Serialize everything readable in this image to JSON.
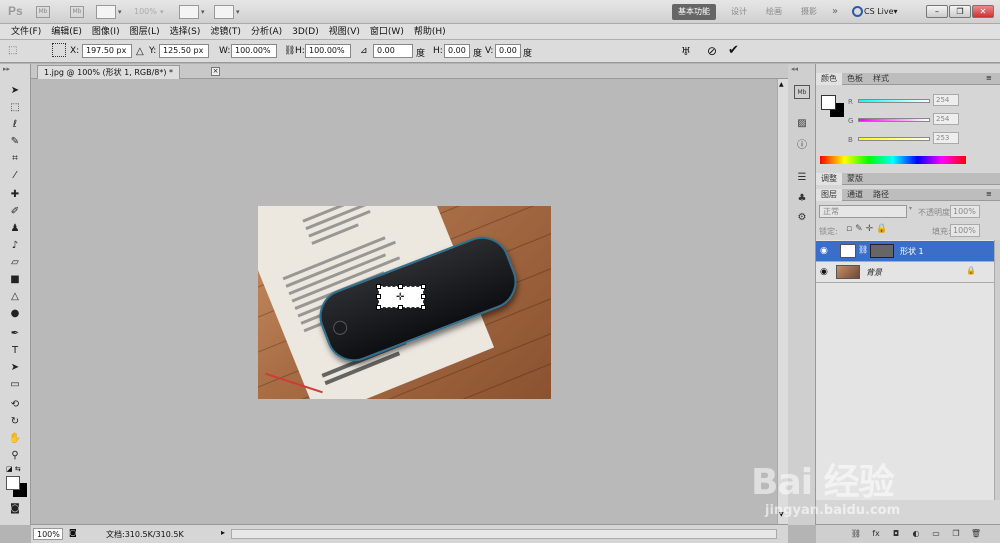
{
  "app": {
    "logo": "Ps",
    "mb_label": "Mb",
    "zoom": "100%"
  },
  "workspaces": [
    "基本功能",
    "设计",
    "绘画",
    "摄影"
  ],
  "cs_live": "CS Live▾",
  "window_buttons": [
    "–",
    "❐",
    "✕"
  ],
  "menu": [
    "文件(F)",
    "编辑(E)",
    "图像(I)",
    "图层(L)",
    "选择(S)",
    "滤镜(T)",
    "分析(A)",
    "3D(D)",
    "视图(V)",
    "窗口(W)",
    "帮助(H)"
  ],
  "options": {
    "x_label": "X:",
    "x_value": "197.50 px",
    "y_label": "Y:",
    "y_value": "125.50 px",
    "w_label": "W:",
    "w_value": "100.00%",
    "h_label": "H:",
    "h_value": "100.00%",
    "angle_value": "0.00",
    "angle_unit": "度",
    "hskew_label": "H:",
    "hskew_value": "0.00",
    "hskew_unit": "度",
    "vskew_label": "V:",
    "vskew_value": "0.00",
    "vskew_unit": "度"
  },
  "document": {
    "tab_title": "1.jpg @ 100% (形状 1, RGB/8*) *",
    "close": "×"
  },
  "status": {
    "zoom": "100%",
    "doc_info": "文档:310.5K/310.5K"
  },
  "color_panel": {
    "tabs": [
      "颜色",
      "色板",
      "样式"
    ],
    "channels": [
      {
        "label": "R",
        "value": "254"
      },
      {
        "label": "G",
        "value": "254"
      },
      {
        "label": "B",
        "value": "253"
      }
    ]
  },
  "adjust_panel": {
    "tabs": [
      "调整",
      "蒙版"
    ]
  },
  "layers_panel": {
    "tabs": [
      "图层",
      "通道",
      "路径"
    ],
    "blend_mode": "正常",
    "opacity_label": "不透明度:",
    "opacity_value": "100%",
    "lock_label": "锁定:",
    "fill_label": "填充:",
    "fill_value": "100%",
    "layers": [
      {
        "name": "形状 1",
        "selected": true
      },
      {
        "name": "背景",
        "selected": false
      }
    ]
  },
  "watermark": {
    "brand": "Bai 经验",
    "url": "jingyan.baidu.com"
  },
  "colors": {
    "selected_layer": "#3a6ec9",
    "accent_blue": "#2a5ba8"
  }
}
